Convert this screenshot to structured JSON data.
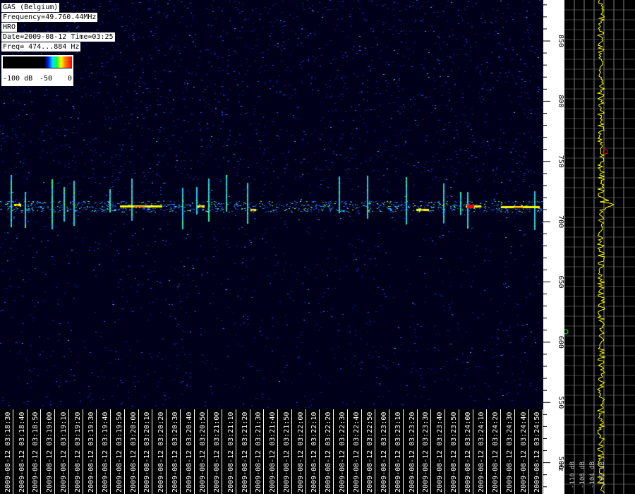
{
  "info": {
    "station": "GAS (Belgium)",
    "frequency": "Frequency=49.760.44MHz",
    "mode": "HRO",
    "datetime": "Date=2009-08-12 Time=03:25",
    "freq_range": "Freq= 474...884 Hz"
  },
  "scale": {
    "min_label": "-100 dB",
    "mid_label": "-50",
    "max_label": "0"
  },
  "freq_axis": {
    "unit": "Hz",
    "ticks": [
      "500",
      "550",
      "600",
      "650",
      "700",
      "750",
      "800",
      "850"
    ]
  },
  "time_axis": {
    "labels": [
      "2009-08-12 03:18:30",
      "2009-08-12 03:18:40",
      "2009-08-12 03:18:50",
      "2009-08-12 03:19:00",
      "2009-08-12 03:19:10",
      "2009-08-12 03:19:20",
      "2009-08-12 03:19:30",
      "2009-08-12 03:19:40",
      "2009-08-12 03:19:50",
      "2009-08-12 03:20:00",
      "2009-08-12 03:20:10",
      "2009-08-12 03:20:20",
      "2009-08-12 03:20:30",
      "2009-08-12 03:20:40",
      "2009-08-12 03:20:50",
      "2009-08-12 03:21:00",
      "2009-08-12 03:21:10",
      "2009-08-12 03:21:20",
      "2009-08-12 03:21:30",
      "2009-08-12 03:21:40",
      "2009-08-12 03:21:50",
      "2009-08-12 03:22:00",
      "2009-08-12 03:22:10",
      "2009-08-12 03:22:20",
      "2009-08-12 03:22:30",
      "2009-08-12 03:22:40",
      "2009-08-12 03:22:50",
      "2009-08-12 03:23:00",
      "2009-08-12 03:23:10",
      "2009-08-12 03:23:20",
      "2009-08-12 03:23:30",
      "2009-08-12 03:23:40",
      "2009-08-12 03:23:50",
      "2009-08-12 03:24:00",
      "2009-08-12 03:24:10",
      "2009-08-12 03:24:20",
      "2009-08-12 03:24:30",
      "2009-08-12 03:24:40",
      "2009-08-12 03:24:50"
    ]
  },
  "scope": {
    "labels": [
      "-110 dB",
      "-108 dB",
      "-104 dB",
      "-102 dB"
    ]
  },
  "colors": {
    "background": "#000000",
    "trace": "#ffff00",
    "grid": "#808080",
    "meteor_core": "#ff0000"
  }
}
